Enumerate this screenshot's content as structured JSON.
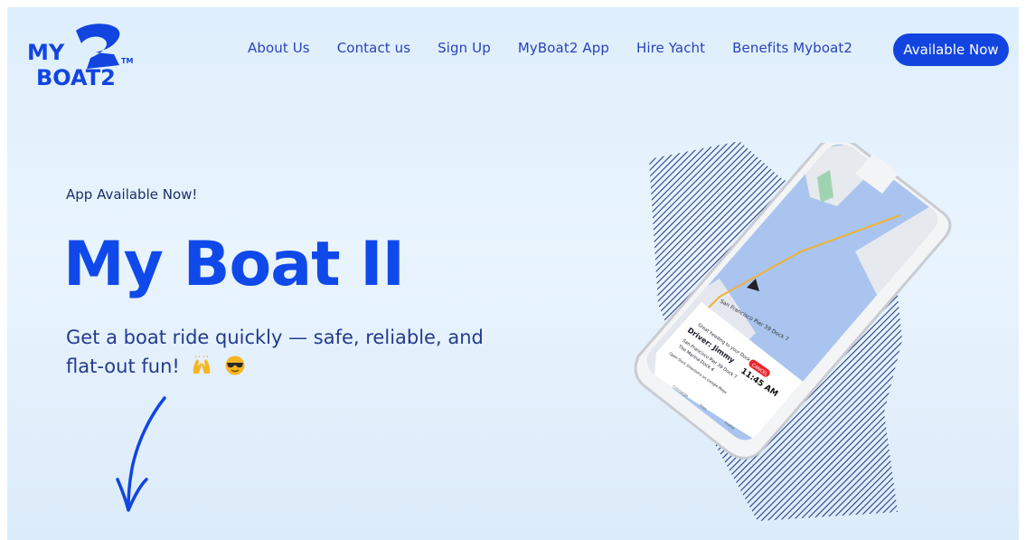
{
  "brand": {
    "logo_text_top": "MY",
    "logo_text_bottom": "BOAT2",
    "logo_tm": "TM",
    "accent": "#1049ea",
    "nav_color": "#2a43b8"
  },
  "nav": {
    "items": [
      {
        "label": "About Us"
      },
      {
        "label": "Contact us"
      },
      {
        "label": "Sign Up"
      },
      {
        "label": "MyBoat2 App"
      },
      {
        "label": "Hire Yacht"
      },
      {
        "label": "Benefits Myboat2"
      }
    ],
    "cta_label": "Available Now"
  },
  "hero": {
    "eyebrow": "App Available Now!",
    "headline": "My Boat II",
    "tagline": "Get a boat ride quickly — safe, reliable, and flat-out fun!"
  },
  "phone_screen": {
    "header": "Great heading to your Dock",
    "driver": "Driver: Jimmy",
    "from": "San Francisco Pier 39 Dock 7",
    "to": "The Marina Dock 4",
    "time": "11:45 AM",
    "cancel_label": "CANCEL",
    "map_label": "San Francisco Pier 39 Dock 7",
    "note": "Open Dock Directions on Google Maps",
    "tabs": [
      {
        "label": "Concierge"
      },
      {
        "label": "Trips"
      },
      {
        "label": "Profile"
      }
    ]
  }
}
